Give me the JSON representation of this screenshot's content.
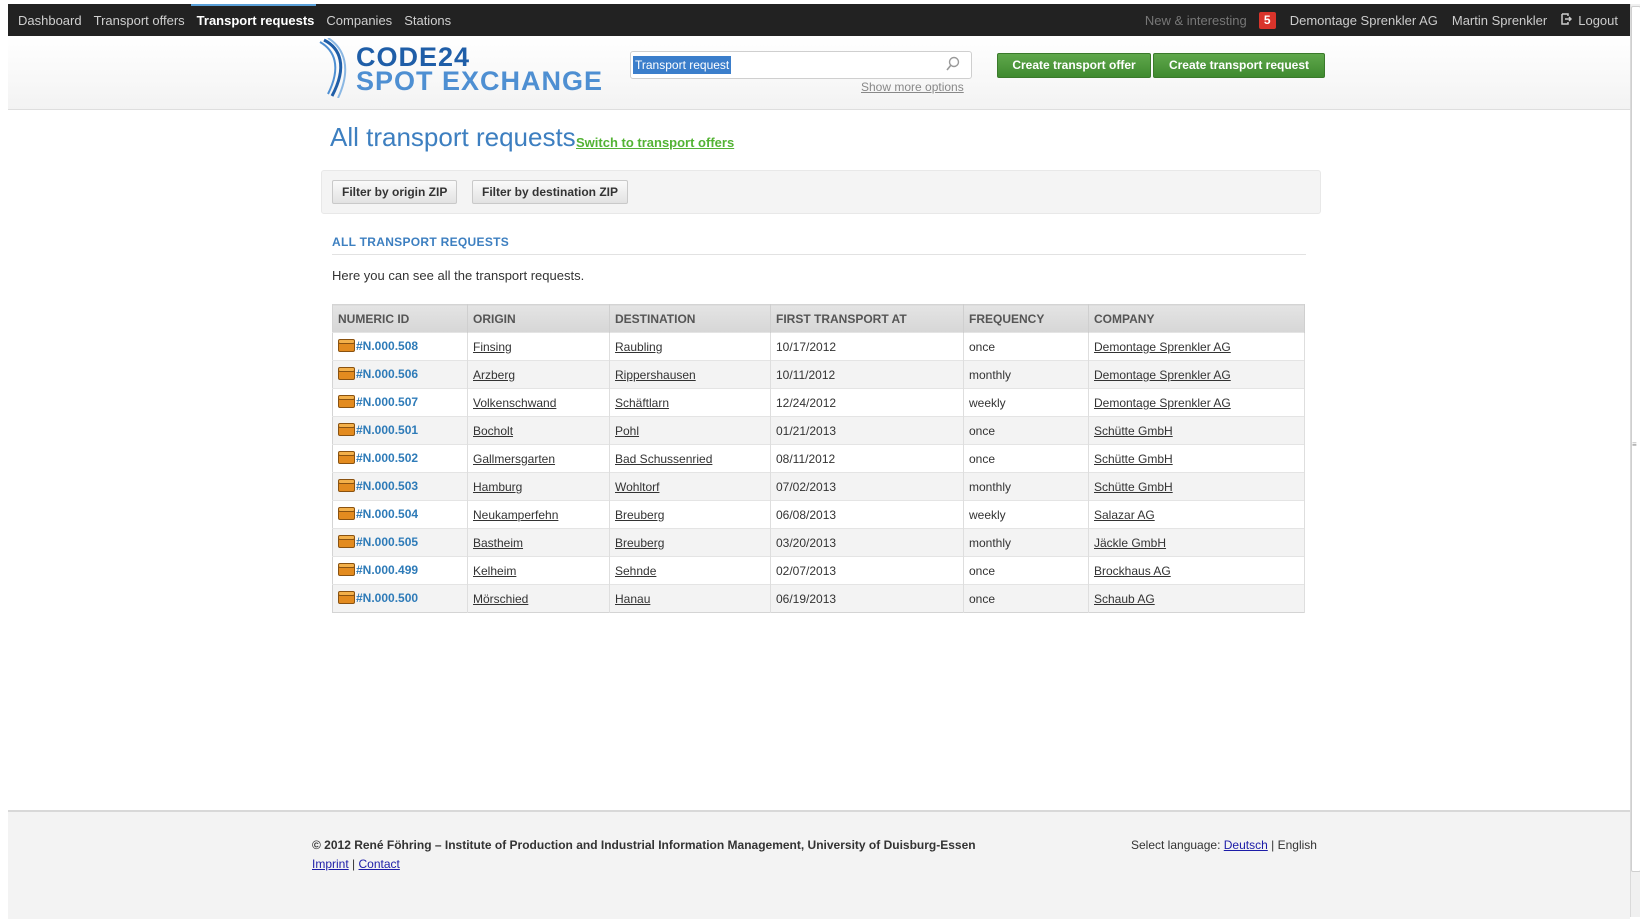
{
  "topnav": {
    "items": [
      {
        "label": "Dashboard",
        "active": false
      },
      {
        "label": "Transport offers",
        "active": false
      },
      {
        "label": "Transport requests",
        "active": true
      },
      {
        "label": "Companies",
        "active": false
      },
      {
        "label": "Stations",
        "active": false
      }
    ],
    "news_label": "New & interesting",
    "news_count": "5",
    "company": "Demontage Sprenkler AG",
    "user": "Martin Sprenkler",
    "logout_label": "Logout"
  },
  "header": {
    "logo_line1": "CODE24",
    "logo_line2": "SPOT EXCHANGE",
    "search_placeholder": "Transport request",
    "more_options": "Show more options",
    "create_offer": "Create transport offer",
    "create_request": "Create transport request"
  },
  "main": {
    "title": "All transport requests",
    "switch_link": "Switch to transport offers",
    "filter_origin": "Filter by origin ZIP",
    "filter_destination": "Filter by destination ZIP",
    "section_title": "ALL TRANSPORT REQUESTS",
    "intro": "Here you can see all the transport requests."
  },
  "table": {
    "columns": [
      "NUMERIC ID",
      "ORIGIN",
      "DESTINATION",
      "FIRST TRANSPORT AT",
      "FREQUENCY",
      "COMPANY"
    ],
    "rows": [
      {
        "id": "#N.000.508",
        "origin": "Finsing",
        "destination": "Raubling",
        "first": "10/17/2012",
        "frequency": "once",
        "company": "Demontage Sprenkler AG"
      },
      {
        "id": "#N.000.506",
        "origin": "Arzberg",
        "destination": "Rippershausen",
        "first": "10/11/2012",
        "frequency": "monthly",
        "company": "Demontage Sprenkler AG"
      },
      {
        "id": "#N.000.507",
        "origin": "Volkenschwand",
        "destination": "Schäftlarn",
        "first": "12/24/2012",
        "frequency": "weekly",
        "company": "Demontage Sprenkler AG"
      },
      {
        "id": "#N.000.501",
        "origin": "Bocholt",
        "destination": "Pohl",
        "first": "01/21/2013",
        "frequency": "once",
        "company": "Schütte GmbH"
      },
      {
        "id": "#N.000.502",
        "origin": "Gallmersgarten",
        "destination": "Bad Schussenried",
        "first": "08/11/2012",
        "frequency": "once",
        "company": "Schütte GmbH"
      },
      {
        "id": "#N.000.503",
        "origin": "Hamburg",
        "destination": "Wohltorf",
        "first": "07/02/2013",
        "frequency": "monthly",
        "company": "Schütte GmbH"
      },
      {
        "id": "#N.000.504",
        "origin": "Neukamperfehn",
        "destination": "Breuberg",
        "first": "06/08/2013",
        "frequency": "weekly",
        "company": "Salazar AG"
      },
      {
        "id": "#N.000.505",
        "origin": "Bastheim",
        "destination": "Breuberg",
        "first": "03/20/2013",
        "frequency": "monthly",
        "company": "Jäckle GmbH"
      },
      {
        "id": "#N.000.499",
        "origin": "Kelheim",
        "destination": "Sehnde",
        "first": "02/07/2013",
        "frequency": "once",
        "company": "Brockhaus AG"
      },
      {
        "id": "#N.000.500",
        "origin": "Mörschied",
        "destination": "Hanau",
        "first": "06/19/2013",
        "frequency": "once",
        "company": "Schaub AG"
      }
    ]
  },
  "footer": {
    "copyright": "© 2012 René Föhring – Institute of Production and Industrial Information Management, University of Duisburg-Essen",
    "imprint": "Imprint",
    "separator": "|",
    "contact": "Contact",
    "lang_label": "Select language:",
    "lang_de": "Deutsch",
    "lang_sep": "|",
    "lang_en": "English"
  },
  "colors": {
    "topbar": "#222222",
    "accent_blue": "#3d7fc0",
    "green_button": "#4c9a3b",
    "link_green": "#53b334",
    "badge_red": "#d9342b"
  },
  "icons": {
    "logout": "logout-icon",
    "search": "magnifier-icon",
    "row": "box-icon"
  }
}
